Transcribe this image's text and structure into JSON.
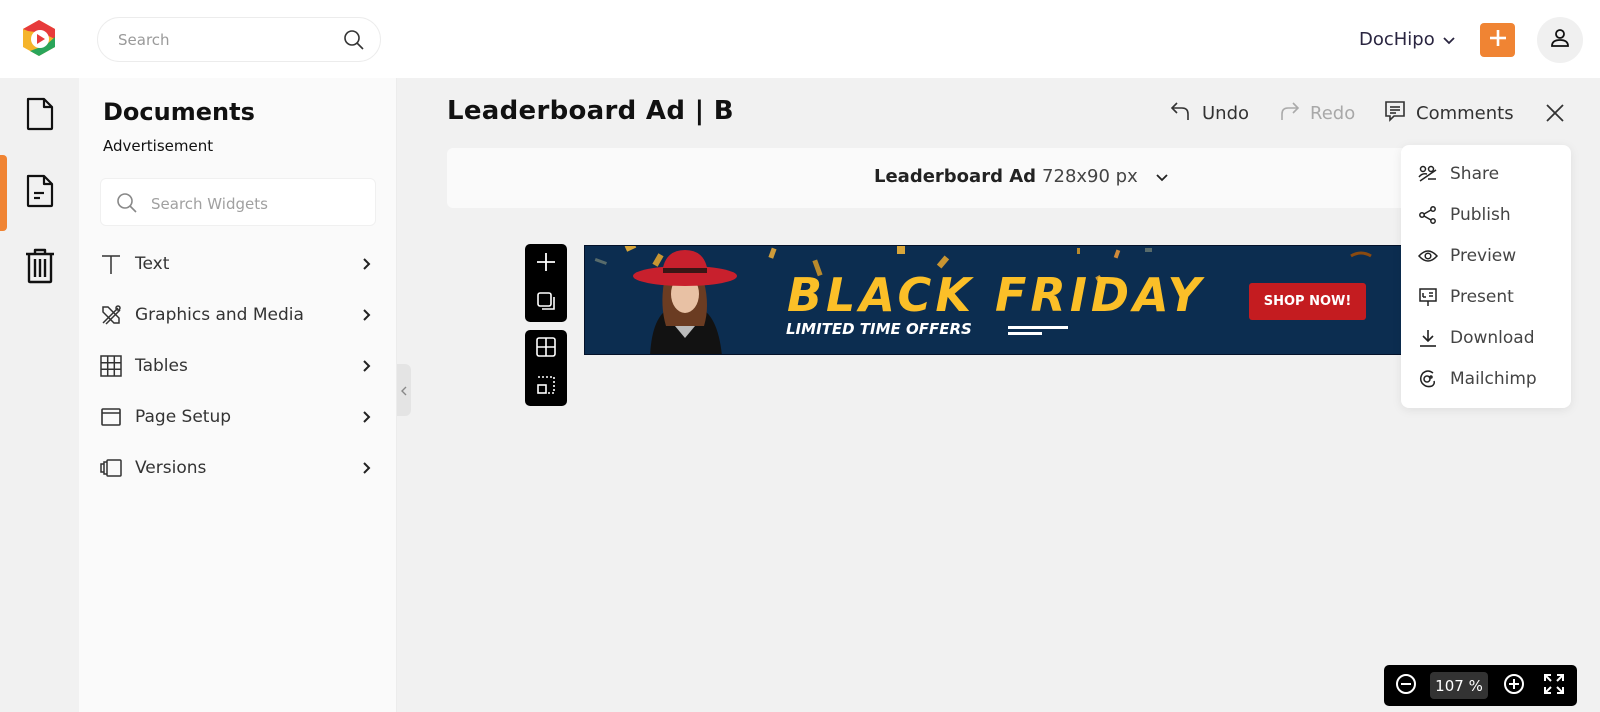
{
  "topbar": {
    "search_placeholder": "Search",
    "brand_menu_label": "DocHipo",
    "add_button_icon": "plus-icon",
    "profile_icon": "user-icon"
  },
  "rail": {
    "items": [
      {
        "name": "documents",
        "icon": "document-icon",
        "active": false
      },
      {
        "name": "current-document",
        "icon": "document-text-icon",
        "active": true
      },
      {
        "name": "trash",
        "icon": "trash-icon",
        "active": false
      }
    ]
  },
  "panel": {
    "title": "Documents",
    "subtitle": "Advertisement",
    "search_placeholder": "Search Widgets",
    "items": [
      {
        "label": "Text",
        "icon": "text-icon"
      },
      {
        "label": "Graphics and Media",
        "icon": "graphics-media-icon"
      },
      {
        "label": "Tables",
        "icon": "table-icon"
      },
      {
        "label": "Page Setup",
        "icon": "page-setup-icon"
      },
      {
        "label": "Versions",
        "icon": "versions-icon"
      }
    ]
  },
  "header": {
    "doc_title": "Leaderboard Ad | B",
    "undo_label": "Undo",
    "redo_label": "Redo",
    "comments_label": "Comments"
  },
  "size_selector": {
    "name": "Leaderboard Ad",
    "dimensions": "728x90 px"
  },
  "banner": {
    "headline": "BLACK FRIDAY",
    "subheadline": "LIMITED TIME OFFERS",
    "cta": "SHOP NOW!",
    "colors": {
      "background": "#0c2d50",
      "headline": "#fbbf28",
      "cta": "#c41c20"
    }
  },
  "share_menu": {
    "items": [
      {
        "label": "Share",
        "icon": "share-people-icon"
      },
      {
        "label": "Publish",
        "icon": "publish-share-icon"
      },
      {
        "label": "Preview",
        "icon": "eye-icon"
      },
      {
        "label": "Present",
        "icon": "presentation-icon"
      },
      {
        "label": "Download",
        "icon": "download-icon"
      },
      {
        "label": "Mailchimp",
        "icon": "mailchimp-icon"
      }
    ]
  },
  "zoom": {
    "value": "107 %"
  },
  "colors": {
    "accent": "#f08433"
  }
}
